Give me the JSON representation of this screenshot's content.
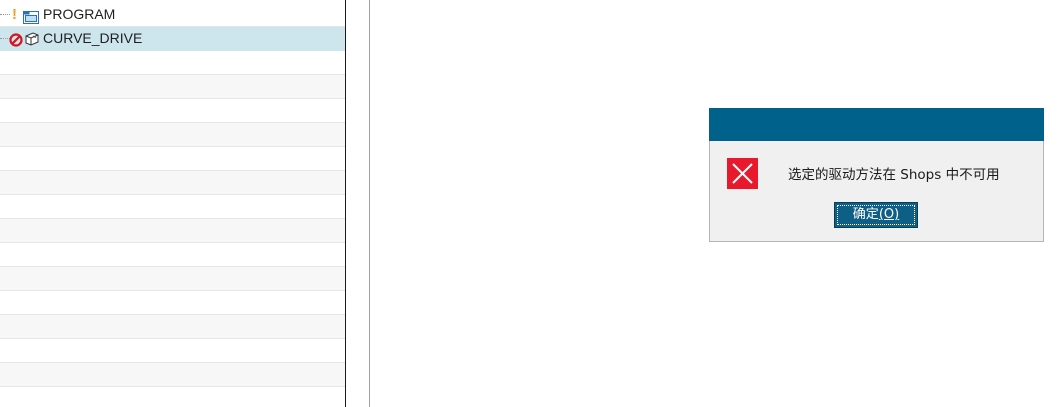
{
  "tree": {
    "nodes": [
      {
        "label": "PROGRAM",
        "status_icon": "warning-icon",
        "type_icon": "folder-icon"
      },
      {
        "label": "CURVE_DRIVE",
        "status_icon": "forbidden-icon",
        "type_icon": "drive-icon",
        "selected": true
      }
    ]
  },
  "dialog": {
    "icon": "error-icon",
    "message": "选定的驱动方法在 Shops 中不可用",
    "ok_label": "确定",
    "ok_accel": "(O)"
  },
  "colors": {
    "titlebar": "#00628a",
    "selection": "#cde6ee",
    "button": "#0e5f86",
    "error": "#e8192c",
    "warning": "#f0a020"
  }
}
